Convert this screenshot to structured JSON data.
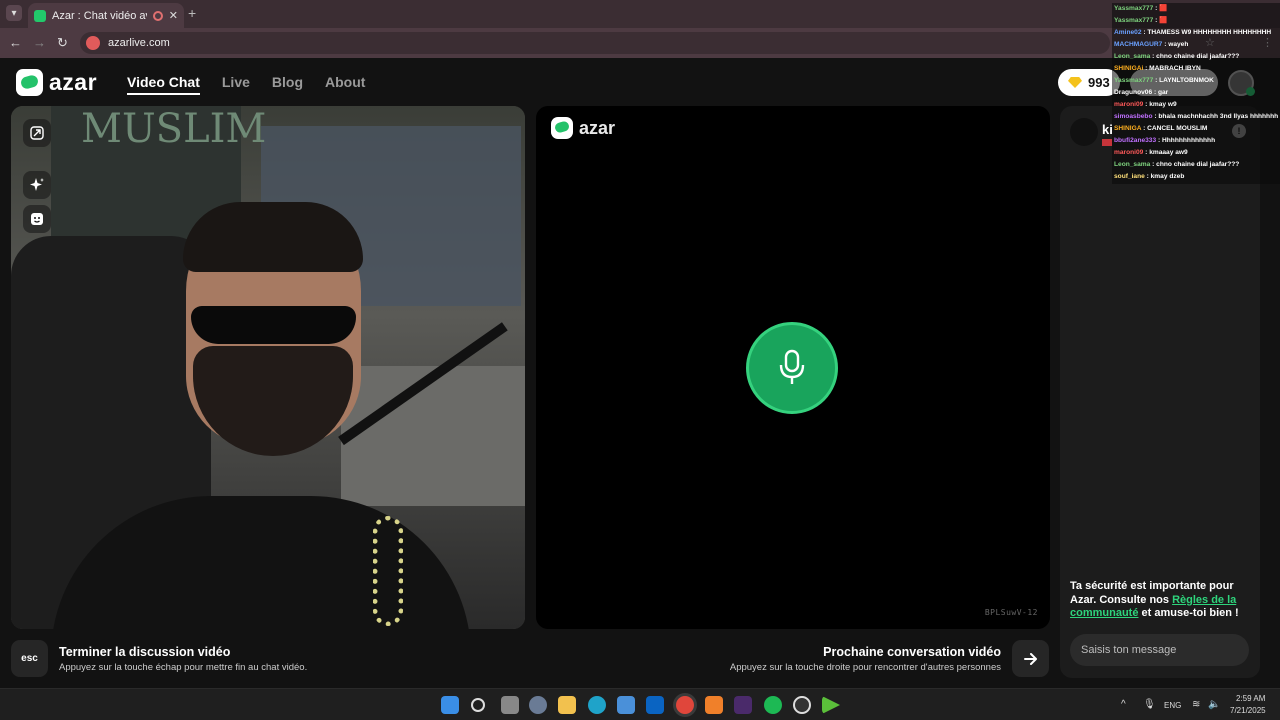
{
  "browser": {
    "tab_title": "Azar : Chat vidéo avec de n",
    "close_glyph": "✕",
    "new_tab_glyph": "+",
    "url": "azarlive.com"
  },
  "header": {
    "logo_text": "azar",
    "nav": [
      {
        "label": "Video Chat",
        "active": true
      },
      {
        "label": "Live",
        "active": false
      },
      {
        "label": "Blog",
        "active": false
      },
      {
        "label": "About",
        "active": false
      }
    ],
    "gems": "993"
  },
  "left_video": {
    "poster_text": "MUSLIM",
    "tools": [
      "expand-icon",
      "sparkle-effects-icon",
      "sticker-face-icon"
    ]
  },
  "mid_video": {
    "logo_text": "azar",
    "session_id": "BPLSuwV-12"
  },
  "chat": {
    "username": "ki",
    "safety_prefix": "Ta sécurité est importante pour Azar. Consulte nos ",
    "safety_link": "Règles de la communauté",
    "safety_suffix": " et amuse-toi bien !",
    "placeholder": "Saisis ton message"
  },
  "controls": {
    "esc_label": "esc",
    "end_title": "Terminer la discussion vidéo",
    "end_sub": "Appuyez sur la touche échap pour mettre fin au chat vidéo.",
    "next_title": "Prochaine conversation vidéo",
    "next_sub": "Appuyez sur la touche droite pour rencontrer d'autres personnes"
  },
  "stream_chat": [
    {
      "user": "Yassmax777",
      "text": " : 🟥",
      "color": "#7fd47f"
    },
    {
      "user": "Yassmax777",
      "text": " : 🟥",
      "color": "#7fd47f"
    },
    {
      "user": "Amine02",
      "text": " : THAMESS W9 HHHHHHHH HHHHHHHH",
      "color": "#6aa0ff"
    },
    {
      "user": "MACHMAGUR7",
      "text": " : wayeh",
      "color": "#6aa0ff"
    },
    {
      "user": "Leon_sama",
      "text": " : chno chaine dial jaafar???",
      "color": "#7fd47f"
    },
    {
      "user": "SHINIGAi",
      "text": " : MABRACH IBYN",
      "color": "#ffb020"
    },
    {
      "user": "Yassmax777",
      "text": " : LAYNLTOBNMOK",
      "color": "#7fd47f"
    },
    {
      "user": "Dragunov06",
      "text": " : gar",
      "color": "#ffffff"
    },
    {
      "user": "maroni09",
      "text": " : kmay w9",
      "color": "#ff5a5a"
    },
    {
      "user": "simoasbebo",
      "text": " : bhala machnhachh 3nd llyas hhhhhhh",
      "color": "#c070ff"
    },
    {
      "user": "SHINIGA",
      "text": " : CANCEL MOUSLIM",
      "color": "#ffb020"
    },
    {
      "user": "bbufi2ane333",
      "text": " : Hhhhhhhhhhhhh",
      "color": "#c070ff"
    },
    {
      "user": "maroni09",
      "text": " : kmaaay aw9",
      "color": "#ff5a5a"
    },
    {
      "user": "Leon_sama",
      "text": " : chno chaine dial jaafar???",
      "color": "#7fd47f"
    },
    {
      "user": "souf_iane",
      "text": " : kmay dzeb",
      "color": "#ffe07a"
    }
  ],
  "taskbar": {
    "lang": "ENG",
    "time": "2:59 AM",
    "date": "7/21/2025",
    "apps": [
      "windows-start-icon",
      "search-icon",
      "task-view-icon",
      "settings-icon",
      "file-explorer-icon",
      "edge-icon",
      "store-icon",
      "outlook-icon",
      "chrome-icon",
      "vlc-icon",
      "next-app-icon",
      "spotify-icon",
      "obs-icon",
      "streaming-app-icon"
    ]
  },
  "colors": {
    "accent": "#24c26a",
    "link": "#2ed47c",
    "gem": "#f4c21c"
  }
}
